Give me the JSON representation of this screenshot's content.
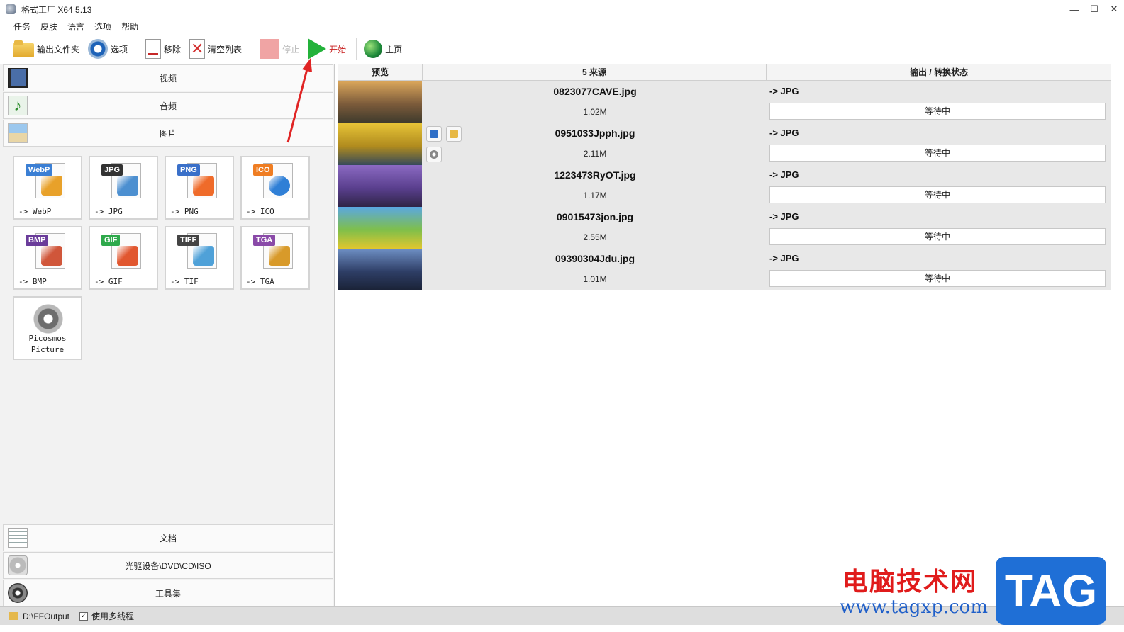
{
  "window": {
    "title": "格式工厂 X64 5.13",
    "controls": [
      "—",
      "☐",
      "✕"
    ]
  },
  "menu": [
    "任务",
    "皮肤",
    "语言",
    "选项",
    "帮助"
  ],
  "toolbar": {
    "output_folder": "输出文件夹",
    "options": "选项",
    "remove": "移除",
    "clear_list": "清空列表",
    "stop": "停止",
    "start": "开始",
    "home": "主页"
  },
  "categories": {
    "video": "视频",
    "audio": "音频",
    "picture": "图片",
    "document": "文档",
    "disc": "光驱设备\\DVD\\CD\\ISO",
    "tools": "工具集"
  },
  "formats": [
    {
      "badge": "WebP",
      "label": "-> WebP",
      "badge_color": "#3b7fd4",
      "art_color": "#e8a12a"
    },
    {
      "badge": "JPG",
      "label": "-> JPG",
      "badge_color": "#333333",
      "art_color": "#4c8fd0"
    },
    {
      "badge": "PNG",
      "label": "-> PNG",
      "badge_color": "#3a70c9",
      "art_color": "#ef6b2a"
    },
    {
      "badge": "ICO",
      "label": "-> ICO",
      "badge_color": "#ef7d22",
      "art_color": "#2f7fd6"
    },
    {
      "badge": "BMP",
      "label": "-> BMP",
      "badge_color": "#6a3c9a",
      "art_color": "#d0563a"
    },
    {
      "badge": "GIF",
      "label": "-> GIF",
      "badge_color": "#2ea94b",
      "art_color": "#e1572f"
    },
    {
      "badge": "TIFF",
      "label": "-> TIF",
      "badge_color": "#444444",
      "art_color": "#4fa1d8"
    },
    {
      "badge": "TGA",
      "label": "-> TGA",
      "badge_color": "#8a4aa8",
      "art_color": "#d89a2a"
    }
  ],
  "picosmos_label": "Picosmos\nPicture",
  "table": {
    "col_preview": "预览",
    "col_source": "5 来源",
    "col_output": "输出 / 转换状态",
    "rows": [
      {
        "name": "0823077CAVE.jpg",
        "size": "1.02M",
        "out": "-> JPG",
        "status": "等待中",
        "thumb": [
          "#d9a55a",
          "#7a5a3a",
          "#3d3a2c"
        ]
      },
      {
        "name": "0951033Jpph.jpg",
        "size": "2.11M",
        "out": "-> JPG",
        "status": "等待中",
        "thumb": [
          "#e7c437",
          "#b08b1e",
          "#364a5a"
        ]
      },
      {
        "name": "1223473RyOT.jpg",
        "size": "1.17M",
        "out": "-> JPG",
        "status": "等待中",
        "thumb": [
          "#8b6ac2",
          "#5a3f8e",
          "#2f2547"
        ]
      },
      {
        "name": "09015473jon.jpg",
        "size": "2.55M",
        "out": "-> JPG",
        "status": "等待中",
        "thumb": [
          "#5aa7e3",
          "#7fbf4a",
          "#e1c62e"
        ]
      },
      {
        "name": "09390304Jdu.jpg",
        "size": "1.01M",
        "out": "-> JPG",
        "status": "等待中",
        "thumb": [
          "#6e8fc4",
          "#2e3e66",
          "#1a2236"
        ]
      }
    ]
  },
  "statusbar": {
    "path": "D:\\FFOutput",
    "multithread": "使用多线程"
  },
  "watermark": {
    "cn": "电脑技术网",
    "url": "www.tagxp.com",
    "tag": "TAG"
  },
  "colors": {
    "start_label": "#c82020",
    "annotation_arrow": "#e02424"
  }
}
